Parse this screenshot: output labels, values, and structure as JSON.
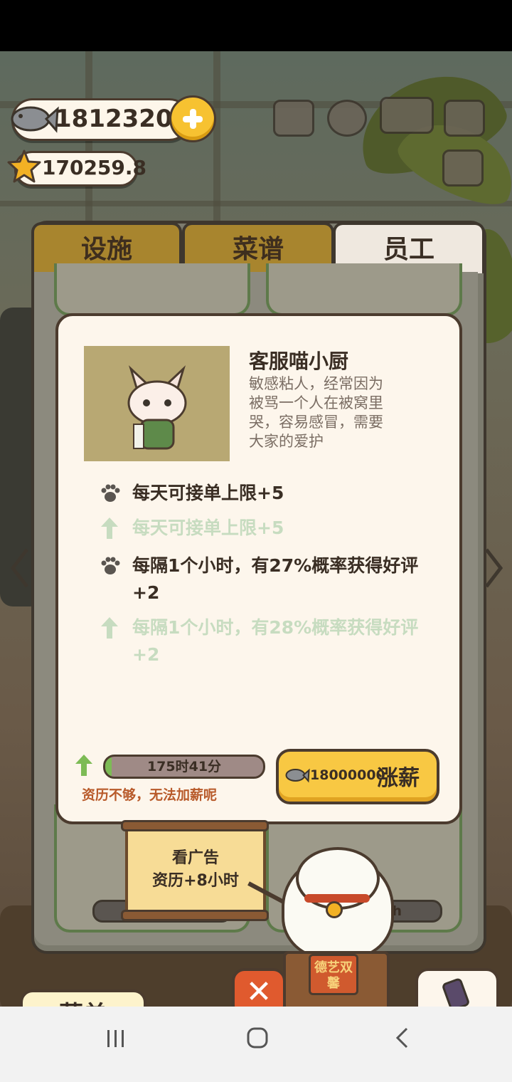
{
  "currency": {
    "fish_amount": "1812320",
    "star_amount": "170259.8"
  },
  "tabs": [
    {
      "label": "设施",
      "active": false
    },
    {
      "label": "菜谱",
      "active": false
    },
    {
      "label": "员工",
      "active": true
    }
  ],
  "staff": {
    "name": "客服喵小厨",
    "description": "敏感粘人，经常因为被骂一个人在被窝里哭，容易感冒，需要大家的爱护",
    "skills": [
      {
        "text": "每天可接单上限+5",
        "kind": "current"
      },
      {
        "text": "每天可接单上限+5",
        "kind": "next"
      },
      {
        "text": "每隔1个小时，有27%概率获得好评+2",
        "kind": "current"
      },
      {
        "text": "每隔1个小时，有28%概率获得好评+2",
        "kind": "next"
      }
    ],
    "experience_text": "175时41分",
    "experience_progress": 0.04,
    "warning": "资历不够，无法加薪呢",
    "raise_cost": "18000000",
    "raise_label": "涨薪"
  },
  "ad_sign": {
    "line1": "看广告",
    "line2": "资历+8小时"
  },
  "bg_card_timer": "35h",
  "banner_text": "德艺双馨",
  "close_label": "✕",
  "menu_label": "菜单",
  "colors": {
    "accent_yellow": "#f8c843",
    "tab_inactive": "#a8852e",
    "dialog_bg": "#fdf6ec",
    "next_level_text": "#c7dcc0",
    "warning_text": "#b85a2a",
    "close_red": "#e05a2e"
  }
}
